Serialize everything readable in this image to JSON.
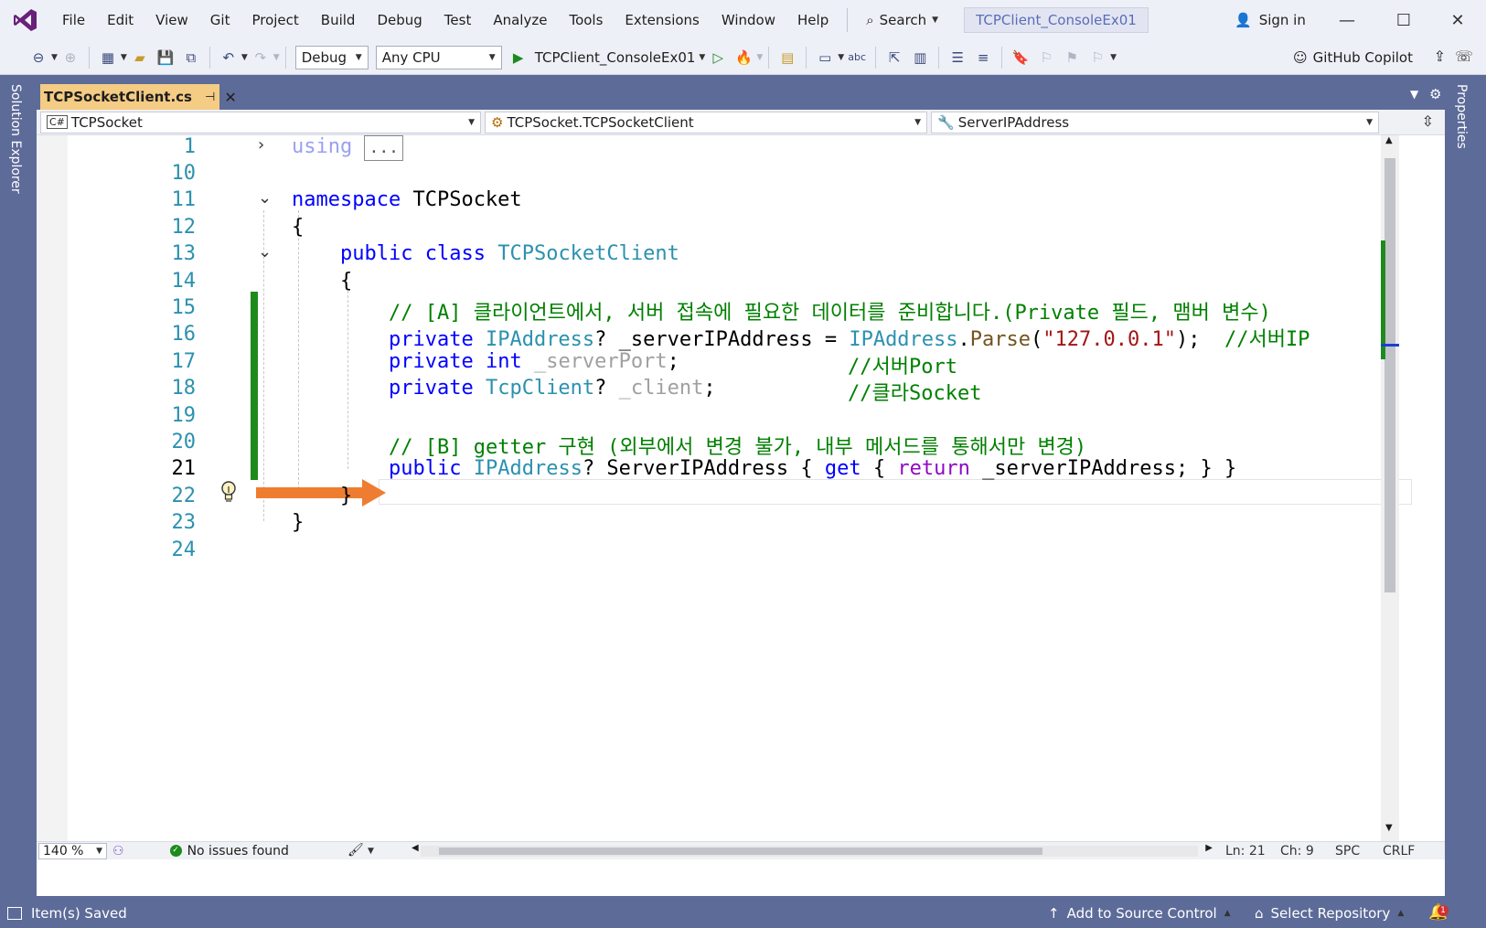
{
  "menubar": {
    "items": [
      "File",
      "Edit",
      "View",
      "Git",
      "Project",
      "Build",
      "Debug",
      "Test",
      "Analyze",
      "Tools",
      "Extensions",
      "Window",
      "Help"
    ],
    "search_label": "Search",
    "solution_name": "TCPClient_ConsoleEx01",
    "sign_in": "Sign in"
  },
  "toolbar": {
    "configuration": "Debug",
    "platform": "Any CPU",
    "startup_project": "TCPClient_ConsoleEx01",
    "copilot": "GitHub Copilot"
  },
  "side_panels": {
    "left": "Solution Explorer",
    "right": "Properties"
  },
  "document_tab": {
    "filename": "TCPSocketClient.cs"
  },
  "navigation_bar": {
    "project": "TCPSocket",
    "type": "TCPSocket.TCPSocketClient",
    "member": "ServerIPAddress"
  },
  "editor": {
    "current_line": 21,
    "line_numbers": [
      "1",
      "10",
      "11",
      "12",
      "13",
      "14",
      "15",
      "16",
      "17",
      "18",
      "19",
      "20",
      "21",
      "22",
      "23",
      "24"
    ],
    "collapsed_using": {
      "keyword": "using",
      "placeholder": "..."
    },
    "lines": {
      "l11": {
        "kw": "namespace",
        "name": " TCPSocket"
      },
      "l12": "{",
      "l13": {
        "kw1": "public",
        "kw2": " class",
        "type": " TCPSocketClient"
      },
      "l14": "{",
      "l15": "// [A] 클라이언트에서, 서버 접속에 필요한 데이터를 준비합니다.(Private 필드, 맴버 변수)",
      "l16": {
        "kw": "private",
        "type": " IPAddress",
        "rest": "? _serverIPAddress = ",
        "type2": "IPAddress",
        "dot": ".",
        "method": "Parse",
        "open": "(",
        "string": "\"127.0.0.1\"",
        "close": ");  ",
        "comment": "//서버IP"
      },
      "l17": {
        "kw": "private",
        "kw2": " int",
        "faded": " _serverPort",
        "semi": ";",
        "comment": "//서버Port"
      },
      "l18": {
        "kw": "private",
        "type": " TcpClient",
        "q": "?",
        "faded": " _client",
        "semi": ";",
        "comment": "//클라Socket"
      },
      "l20": "// [B] getter 구현 (외부에서 변경 불가, 내부 메서드를 통해서만 변경)",
      "l21": {
        "kw": "public",
        "type": " IPAddress",
        "q": "? ServerIPAddress { ",
        "get": "get",
        "brace": " { ",
        "ret": "return",
        "rest": " _serverIPAddress; } }"
      },
      "l22": "}",
      "l23": "}"
    }
  },
  "editor_status": {
    "zoom": "140 %",
    "issues": "No issues found",
    "line": "Ln: 21",
    "char": "Ch: 9",
    "whitespace": "SPC",
    "line_ending": "CRLF"
  },
  "statusbar": {
    "message": "Item(s) Saved",
    "source_control": "Add to Source Control",
    "repository": "Select Repository",
    "notifications": "1"
  },
  "colors": {
    "chrome": "#5d6b99",
    "active_tab": "#f5cc84",
    "keyword": "#0000ff",
    "type": "#2b91af",
    "comment": "#008000",
    "string": "#a31515",
    "change_bar": "#1e8a1e",
    "arrow": "#ee7d31"
  }
}
